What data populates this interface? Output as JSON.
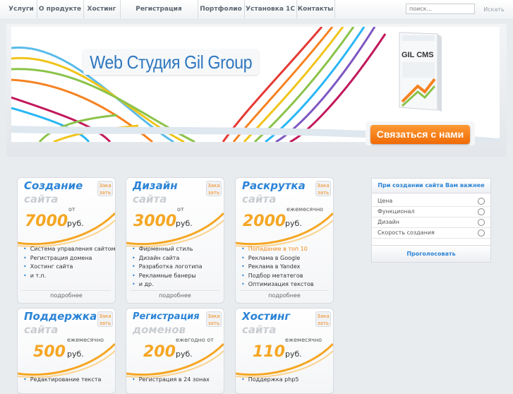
{
  "nav": {
    "items": [
      "Услуги",
      "О продукте",
      "Хостинг",
      "Регистрация доменов",
      "Портфолио",
      "Установка 1С",
      "Контакты"
    ],
    "search_placeholder": "поиск...",
    "search_button": "Искать"
  },
  "banner": {
    "title": "Web Студия Gil Group",
    "cms_label": "GIL CMS",
    "contact_button": "Связаться с нами"
  },
  "cards": [
    {
      "title1": "Создание",
      "title2": "сайта",
      "order": "Зака зать",
      "price_prefix": "от",
      "price": "7000",
      "unit": "руб.",
      "items": [
        "Система управления сайтом",
        "Регистрация домена",
        "Хостинг сайта",
        "и т.п."
      ],
      "more": "подробнее"
    },
    {
      "title1": "Дизайн",
      "title2": "сайта",
      "order": "Зака зать",
      "price_prefix": "от",
      "price": "3000",
      "unit": "руб.",
      "items": [
        "Фирменный стиль",
        "Дизайн сайта",
        "Разработка логотипа",
        "Рекламные банеры",
        "и др."
      ],
      "more": "подробнее"
    },
    {
      "title1": "Раскрутка",
      "title2": "сайта",
      "order": "Зака зать",
      "price_prefix": "ежемесячно",
      "price": "2000",
      "unit": "руб.",
      "items": [
        "Попадание в топ 10",
        "Реклама в Google",
        "Реклама в Yandex",
        "Подбор метатегов",
        "Оптимизация текстов"
      ],
      "more": "подробнее"
    },
    {
      "title1": "Поддержка",
      "title2": "сайта",
      "order": "Зака зать",
      "price_prefix": "ежемесячно",
      "price": "500",
      "unit": "руб.",
      "items": [
        "Редактирование текста"
      ],
      "more": ""
    },
    {
      "title1": "Регистрация",
      "title2": "доменов",
      "order": "Зака зать",
      "price_prefix": "ежегодно от",
      "price": "200",
      "unit": "руб.",
      "items": [
        "Регистрация в 24 зонах"
      ],
      "more": ""
    },
    {
      "title1": "Хостинг",
      "title2": "сайта",
      "order": "Зака зать",
      "price_prefix": "ежемесячно",
      "price": "110",
      "unit": "руб.",
      "items": [
        "Поддержка php5"
      ],
      "more": ""
    }
  ],
  "poll": {
    "question": "При создании сайта Вам важнее",
    "options": [
      "Цена",
      "Функционал",
      "Дизайн",
      "Скорость создания"
    ],
    "vote_button": "Проголосовать"
  },
  "colors": {
    "accent_blue": "#2c84d6",
    "accent_orange": "#f5a623",
    "button_orange": "#ef6a05"
  }
}
